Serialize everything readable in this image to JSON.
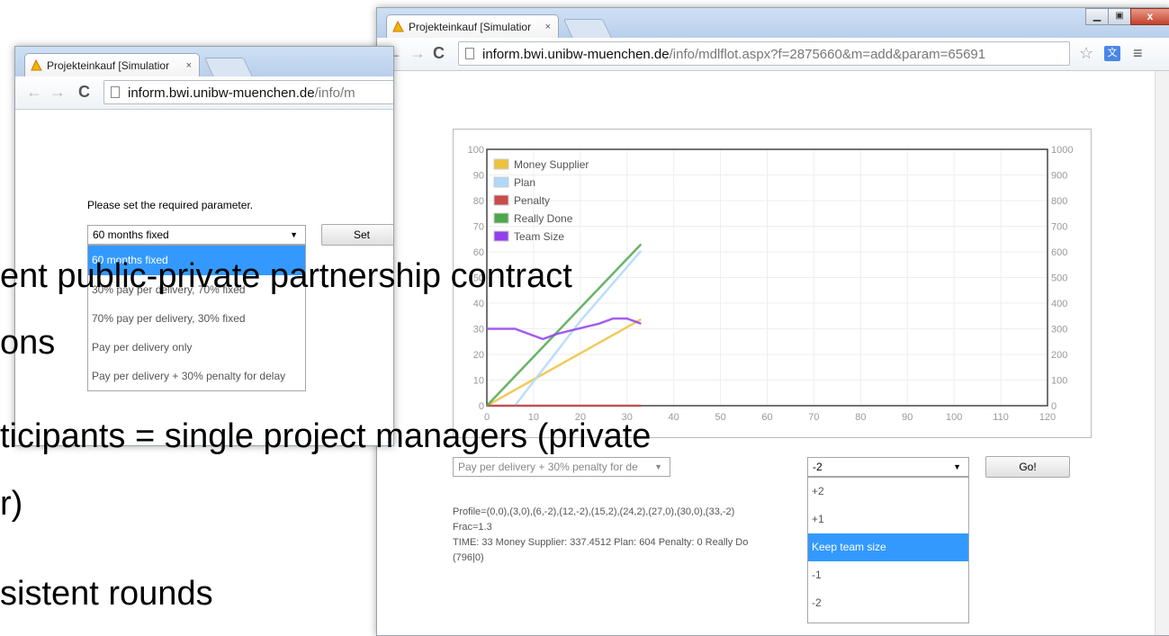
{
  "left_window": {
    "tab_title": "Projekteinkauf [Simulatior",
    "tab_close": "×",
    "url_host": "inform.bwi.unibw-muenchen.de",
    "url_path": "/info/m",
    "prompt": "Please set the required parameter.",
    "select_value": "60 months fixed",
    "set_button": "Set",
    "options": [
      "60 months fixed",
      "30% pay per delivery, 70% fixed",
      "70% pay per delivery, 30% fixed",
      "Pay per delivery only",
      "Pay per delivery + 30% penalty for delay"
    ]
  },
  "right_window": {
    "tab_title": "Projekteinkauf [Simulatior",
    "tab_close": "×",
    "url_host": "inform.bwi.unibw-muenchen.de",
    "url_path": "/info/mdlflot.aspx?f=2875660&m=add&param=65691",
    "contract_select": "Pay per delivery + 30% penalty for de",
    "team_select": "-2",
    "go_button": "Go!",
    "team_options": [
      "+2",
      "+1",
      "Keep team size",
      "-1",
      "-2"
    ],
    "output_lines": [
      "Profile=(0,0),(3,0),(6,-2),(12,-2),(15,2),(24,2),(27,0),(30,0),(33,-2)",
      "Frac=1.3",
      "TIME: 33 Money Supplier: 337.4512 Plan: 604 Penalty: 0 Really Do",
      "(796|0)"
    ]
  },
  "slide_text": [
    "ent public-private partnership contract",
    "ons",
    "ticipants = single project managers (private",
    "r)",
    "sistent rounds"
  ],
  "chart_data": {
    "type": "line",
    "x_ticks": [
      0,
      10,
      20,
      30,
      40,
      50,
      60,
      70,
      80,
      90,
      100,
      110,
      120
    ],
    "y_left_ticks": [
      0,
      10,
      20,
      30,
      40,
      50,
      60,
      70,
      80,
      90,
      100
    ],
    "y_right_ticks": [
      0,
      100,
      200,
      300,
      400,
      500,
      600,
      700,
      800,
      900,
      1000
    ],
    "xlim": [
      0,
      120
    ],
    "ylim_left": [
      0,
      100
    ],
    "ylim_right": [
      0,
      1000
    ],
    "grid": true,
    "legend_position": "top-left",
    "series": [
      {
        "name": "Money Supplier",
        "color": "#edc240",
        "axis": "right",
        "x": [
          0,
          33
        ],
        "y": [
          0,
          337
        ]
      },
      {
        "name": "Plan",
        "color": "#afd8f8",
        "axis": "right",
        "x": [
          6,
          20,
          33
        ],
        "y": [
          0,
          330,
          604
        ]
      },
      {
        "name": "Penalty",
        "color": "#cb4b4b",
        "axis": "right",
        "x": [
          0,
          33
        ],
        "y": [
          0,
          0
        ]
      },
      {
        "name": "Really Done",
        "color": "#4da74d",
        "axis": "right",
        "x": [
          0,
          33
        ],
        "y": [
          0,
          630
        ]
      },
      {
        "name": "Team Size",
        "color": "#9440ed",
        "axis": "left",
        "x": [
          0,
          6,
          12,
          15,
          24,
          27,
          30,
          33
        ],
        "y": [
          30,
          30,
          26,
          28,
          32,
          34,
          34,
          32
        ]
      }
    ]
  }
}
